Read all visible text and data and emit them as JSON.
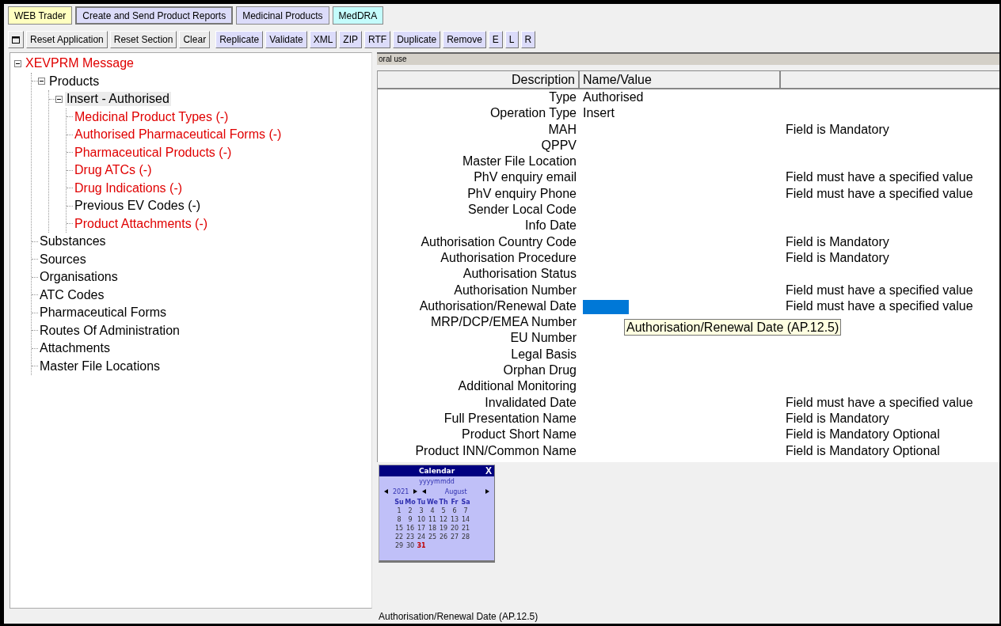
{
  "tabs": [
    {
      "label": "WEB Trader",
      "selected": false,
      "color": "#ffffc0"
    },
    {
      "label": "Create and Send Product Reports",
      "selected": true,
      "color": "#dcdcfa"
    },
    {
      "label": "Medicinal Products",
      "selected": false,
      "color": "#dcdcfa"
    },
    {
      "label": "MedDRA",
      "selected": false,
      "color": "#c4fcfc"
    }
  ],
  "toolbar": [
    {
      "kind": "icon"
    },
    {
      "kind": "general",
      "label": "Reset Application"
    },
    {
      "kind": "general",
      "label": "Reset Section"
    },
    {
      "kind": "general",
      "label": "Clear"
    },
    {
      "kind": "section",
      "label": "Replicate"
    },
    {
      "kind": "section",
      "label": "Validate"
    },
    {
      "kind": "section",
      "label": "XML"
    },
    {
      "kind": "section",
      "label": "ZIP"
    },
    {
      "kind": "section",
      "label": "RTF"
    },
    {
      "kind": "section",
      "label": "Duplicate"
    },
    {
      "kind": "section",
      "label": "Remove"
    },
    {
      "kind": "section",
      "label": "E"
    },
    {
      "kind": "section",
      "label": "L"
    },
    {
      "kind": "section",
      "label": "R"
    }
  ],
  "tree": [
    {
      "label": "XEVPRM Message",
      "error": true,
      "selected": false,
      "expanded": true,
      "children": [
        {
          "label": "Products",
          "error": false,
          "selected": false,
          "expanded": true,
          "children": [
            {
              "label": "Insert - Authorised",
              "error": false,
              "selected": true,
              "expanded": true,
              "children": [
                {
                  "label": "Medicinal Product Types (-)",
                  "error": true,
                  "selected": false
                },
                {
                  "label": "Authorised Pharmaceutical Forms (-)",
                  "error": true,
                  "selected": false
                },
                {
                  "label": "Pharmaceutical Products (-)",
                  "error": true,
                  "selected": false
                },
                {
                  "label": "Drug ATCs (-)",
                  "error": true,
                  "selected": false
                },
                {
                  "label": "Drug Indications (-)",
                  "error": true,
                  "selected": false
                },
                {
                  "label": "Previous EV Codes (-)",
                  "error": false,
                  "selected": false
                },
                {
                  "label": "Product Attachments (-)",
                  "error": true,
                  "selected": false
                }
              ]
            }
          ]
        },
        {
          "label": "Substances",
          "error": false,
          "selected": false
        },
        {
          "label": "Sources",
          "error": false,
          "selected": false
        },
        {
          "label": "Organisations",
          "error": false,
          "selected": false
        },
        {
          "label": "ATC Codes",
          "error": false,
          "selected": false
        },
        {
          "label": "Pharmaceutical Forms",
          "error": false,
          "selected": false
        },
        {
          "label": "Routes Of Administration",
          "error": false,
          "selected": false
        },
        {
          "label": "Attachments",
          "error": false,
          "selected": false
        },
        {
          "label": "Master File Locations",
          "error": false,
          "selected": false
        }
      ]
    }
  ],
  "path_bar": "oral use",
  "table": {
    "columns": [
      "Description",
      "Name/Value"
    ],
    "rows": [
      {
        "description": "Type",
        "value": "Authorised",
        "editing": false
      },
      {
        "description": "Operation Type",
        "value": "Insert",
        "editing": false
      },
      {
        "description": "MAH",
        "message": "Field is Mandatory",
        "editing": false
      },
      {
        "description": "QPPV",
        "editing": false
      },
      {
        "description": "Master File Location",
        "editing": false
      },
      {
        "description": "PhV enquiry email",
        "message": "Field must have a specified value",
        "editing": false
      },
      {
        "description": "PhV enquiry Phone",
        "message": "Field must have a specified value",
        "editing": false
      },
      {
        "description": "Sender Local Code",
        "editing": false
      },
      {
        "description": "Info Date",
        "editing": false
      },
      {
        "description": "Authorisation Country Code",
        "message": "Field is Mandatory",
        "editing": false
      },
      {
        "description": "Authorisation Procedure",
        "message": "Field is Mandatory",
        "editing": false
      },
      {
        "description": "Authorisation Status",
        "editing": false
      },
      {
        "description": "Authorisation Number",
        "message": "Field must have a specified value",
        "editing": false
      },
      {
        "description": "Authorisation/Renewal Date",
        "message": "Field must have a specified value",
        "editing": true,
        "tooltip": "Authorisation/Renewal Date (AP.12.5)"
      },
      {
        "description": "MRP/DCP/EMEA Number",
        "editing": false
      },
      {
        "description": "EU Number",
        "editing": false
      },
      {
        "description": "Legal Basis",
        "editing": false
      },
      {
        "description": "Orphan Drug",
        "editing": false
      },
      {
        "description": "Additional Monitoring",
        "editing": false
      },
      {
        "description": "Invalidated Date",
        "message": "Field must have a specified value",
        "editing": false
      },
      {
        "description": "Full Presentation Name",
        "message": "Field is Mandatory",
        "editing": false
      },
      {
        "description": "Product Short Name",
        "message": "Field is Mandatory Optional",
        "editing": false
      },
      {
        "description": "Product INN/Common Name",
        "message": "Field is Mandatory Optional",
        "editing": false
      }
    ]
  },
  "calendar": {
    "title": "Calendar",
    "close": "X",
    "format": "yyyymmdd",
    "year": "2021",
    "month": "August",
    "weekdays": [
      "Su",
      "Mo",
      "Tu",
      "We",
      "Th",
      "Fr",
      "Sa"
    ],
    "days": [
      {
        "day": "1",
        "selected": false
      },
      {
        "day": "2",
        "selected": false
      },
      {
        "day": "3",
        "selected": false
      },
      {
        "day": "4",
        "selected": false
      },
      {
        "day": "5",
        "selected": false
      },
      {
        "day": "6",
        "selected": false
      },
      {
        "day": "7",
        "selected": false
      },
      {
        "day": "8",
        "selected": false
      },
      {
        "day": "9",
        "selected": false
      },
      {
        "day": "10",
        "selected": false
      },
      {
        "day": "11",
        "selected": false
      },
      {
        "day": "12",
        "selected": false
      },
      {
        "day": "13",
        "selected": false
      },
      {
        "day": "14",
        "selected": false
      },
      {
        "day": "15",
        "selected": false
      },
      {
        "day": "16",
        "selected": false
      },
      {
        "day": "17",
        "selected": false
      },
      {
        "day": "18",
        "selected": false
      },
      {
        "day": "19",
        "selected": false
      },
      {
        "day": "20",
        "selected": false
      },
      {
        "day": "21",
        "selected": false
      },
      {
        "day": "22",
        "selected": false
      },
      {
        "day": "23",
        "selected": false
      },
      {
        "day": "24",
        "selected": false
      },
      {
        "day": "25",
        "selected": false
      },
      {
        "day": "26",
        "selected": false
      },
      {
        "day": "27",
        "selected": false
      },
      {
        "day": "28",
        "selected": false
      },
      {
        "day": "29",
        "selected": false
      },
      {
        "day": "30",
        "selected": false
      },
      {
        "day": "31",
        "selected": true
      }
    ]
  },
  "status_bar": "Authorisation/Renewal Date (AP.12.5)"
}
